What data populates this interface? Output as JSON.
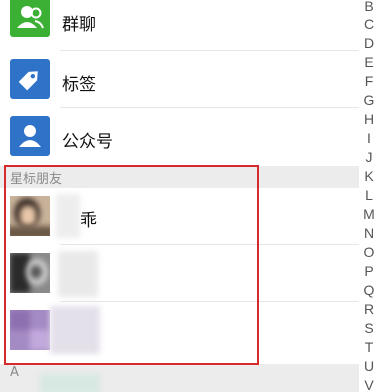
{
  "menu": {
    "items": [
      {
        "label": "群聊",
        "icon": "group-chat-icon",
        "color": "#3cb035"
      },
      {
        "label": "标签",
        "icon": "tag-icon",
        "color": "#2f73c9"
      },
      {
        "label": "公众号",
        "icon": "official-account-icon",
        "color": "#2f73c9"
      }
    ]
  },
  "starred": {
    "header": "星标朋友",
    "contacts": [
      {
        "name": "乖"
      },
      {
        "name": ""
      },
      {
        "name": ""
      }
    ]
  },
  "next_section": {
    "header": "A"
  },
  "alphabet_index": [
    "B",
    "C",
    "D",
    "E",
    "F",
    "G",
    "H",
    "I",
    "J",
    "K",
    "L",
    "M",
    "N",
    "O",
    "P",
    "Q",
    "R",
    "S",
    "T",
    "U",
    "V"
  ]
}
